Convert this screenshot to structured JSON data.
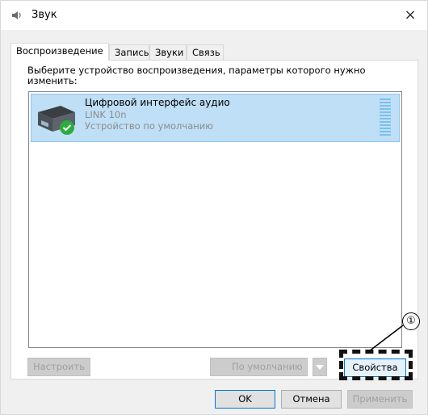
{
  "window": {
    "title": "Звук",
    "close_label": "×"
  },
  "tabs": [
    {
      "label": "Воспроизведение",
      "active": true
    },
    {
      "label": "Запись",
      "active": false
    },
    {
      "label": "Звуки",
      "active": false
    },
    {
      "label": "Связь",
      "active": false
    }
  ],
  "panel": {
    "prompt": "Выберите устройство воспроизведения, параметры которого нужно изменить:",
    "devices": [
      {
        "name": "Цифровой интерфейс аудио",
        "model": "LINK 10n",
        "status": "Устройство по умолчанию",
        "selected": true,
        "default": true,
        "icon": "digital-audio-device-icon"
      }
    ]
  },
  "buttons": {
    "configure": "Настроить",
    "set_default": "По умолчанию",
    "properties": "Свойства",
    "ok": "OK",
    "cancel": "Отмена",
    "apply": "Применить"
  },
  "annotation": {
    "marker": "①"
  },
  "colors": {
    "selection": "#bfdff7",
    "accent": "#0078d7",
    "check": "#2eab3f"
  }
}
